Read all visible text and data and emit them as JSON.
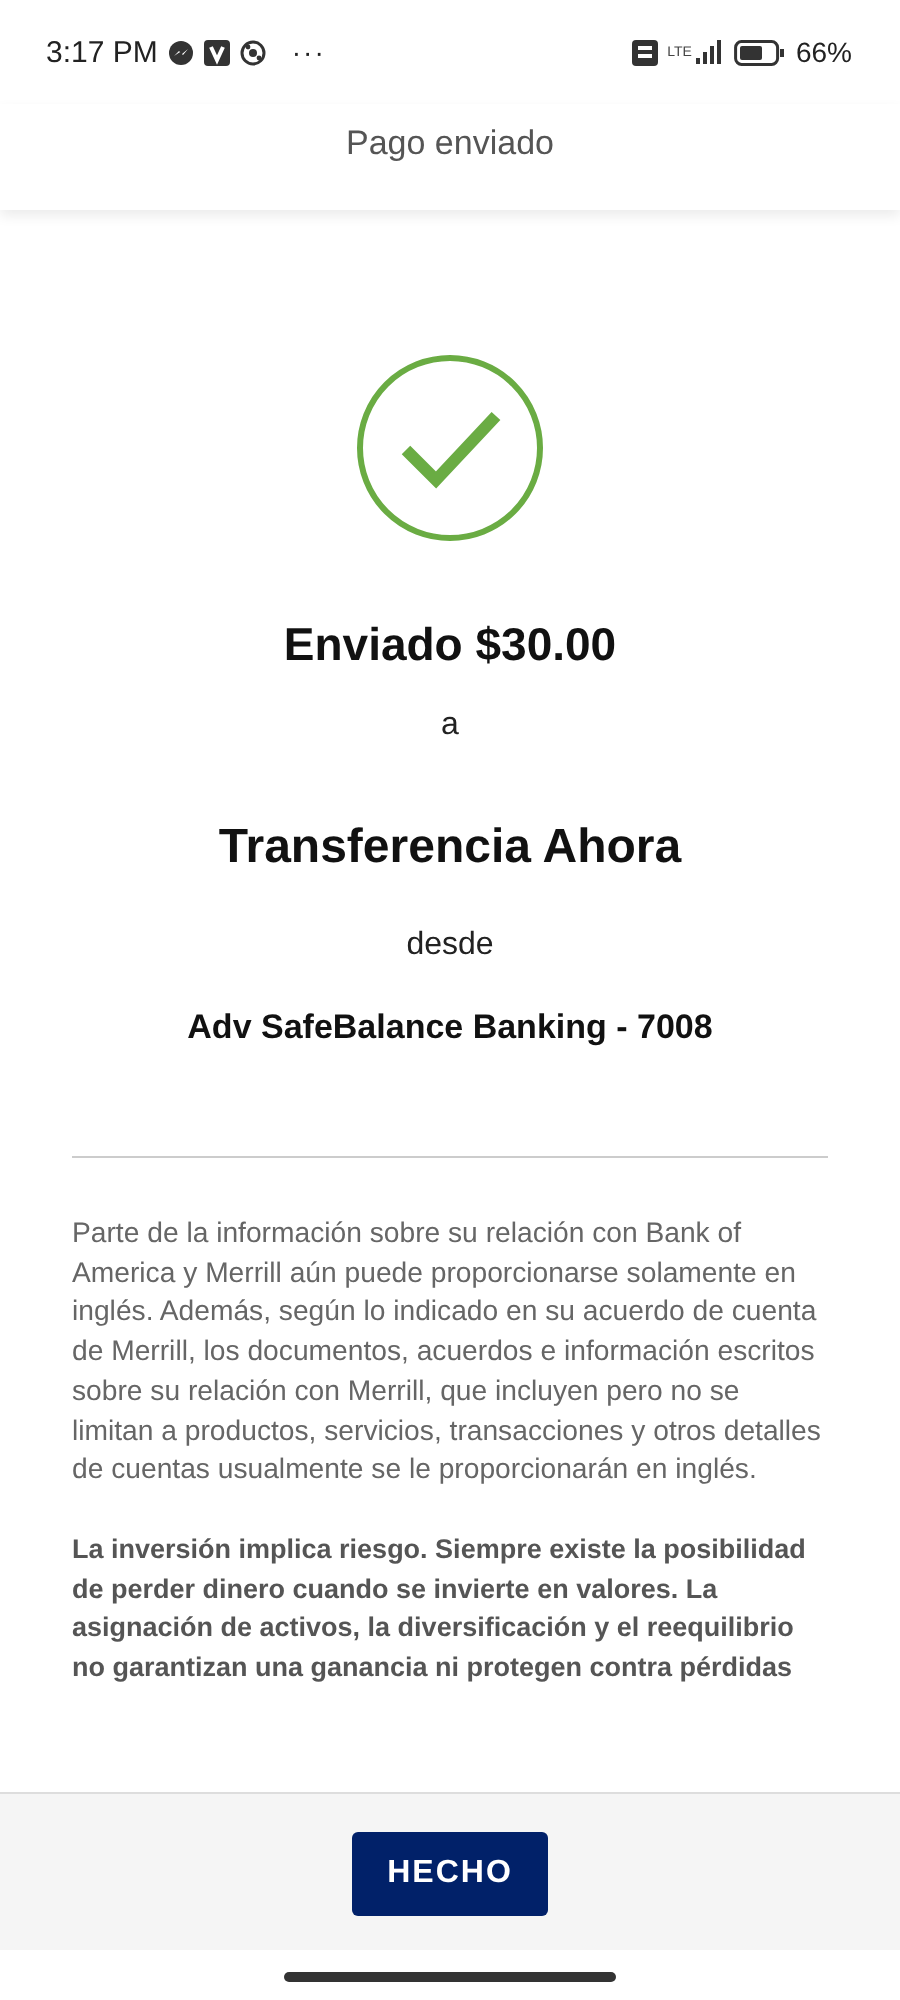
{
  "status_bar": {
    "time": "3:17 PM",
    "more": "···",
    "network": "LTE",
    "battery": "66%"
  },
  "header": {
    "title": "Pago enviado"
  },
  "confirmation": {
    "amount_line": "Enviado $30.00",
    "to": "a",
    "recipient": "Transferencia Ahora",
    "from": "desde",
    "account": "Adv SafeBalance Banking - 7008"
  },
  "disclosures": [
    "Parte de la información sobre su relación con Bank of America y Merrill aún puede proporcionarse solamente en inglés. Además, según lo indicado en su acuerdo de cuenta de Merrill, los documentos, acuerdos e información escritos sobre su relación con Merrill, que incluyen pero no se limitan a productos, servicios, transacciones y otros detalles de cuentas usualmente se le proporcionarán en inglés.",
    "La inversión implica riesgo. Siempre existe la posibilidad de perder dinero cuando se invierte en valores. La asignación de activos, la diversificación y el reequilibrio no garantizan una ganancia ni protegen contra pérdidas"
  ],
  "footer": {
    "button": "HECHO"
  }
}
